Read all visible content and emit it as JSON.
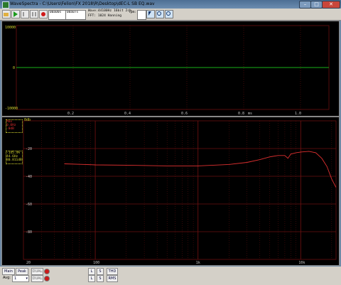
{
  "window": {
    "title": "WaveSpectra - C:\\Users\\Felion\\FX 2018\\R\\Desktop\\dEC-L SB EQ.wav",
    "min_glyph": "–",
    "max_glyph": "□",
    "close_glyph": "✕"
  },
  "toolbar": {
    "readout1": "00a00s",
    "readout2": "00a07s",
    "info_line1": "Wave:44100Hz 16bit 2ch",
    "info_line2": "FFT: 1024 Hanning",
    "fps_label": "fps:"
  },
  "wave_pane": {
    "y_max": "10000",
    "y_zero": "0",
    "y_min": "-10000",
    "x_ticks": [
      "0.2",
      "0.4",
      "0.6",
      "0.8",
      "1.0"
    ],
    "x_unit": "ms"
  },
  "spectrum_pane": {
    "top_label": "0db",
    "info_top": [
      "Max",
      "0.0Hz",
      "-0dB"
    ],
    "info_mid": [
      "-145.4%",
      "44.6Hz",
      "80.811dB"
    ],
    "y_ticks": [
      "-20",
      "-40",
      "-60",
      "-80"
    ],
    "x_ticks": [
      "20",
      "100",
      "1k",
      "10k"
    ]
  },
  "chart_data": {
    "type": "line",
    "title": "",
    "xlabel": "",
    "ylabel": "",
    "xscale": "log",
    "xlim": [
      20,
      22050
    ],
    "ylim": [
      -100,
      0
    ],
    "grid": true,
    "series": [
      {
        "color": "#e03030",
        "x": [
          50,
          80,
          100,
          200,
          500,
          1000,
          2000,
          3000,
          4000,
          5000,
          6000,
          7000,
          7500,
          8000,
          9000,
          10000,
          12000,
          14000,
          16000,
          18000,
          20000,
          22000
        ],
        "y": [
          -31,
          -31.5,
          -31.8,
          -32,
          -32.5,
          -32.5,
          -31.5,
          -30,
          -28,
          -26,
          -25,
          -25,
          -27,
          -24,
          -23,
          -22.5,
          -22,
          -23,
          -27,
          -33,
          -42,
          -48
        ]
      }
    ]
  },
  "bottom": {
    "row1": {
      "main": "Main",
      "peak": "Peak",
      "dual": "DUAL",
      "l": "L",
      "s": "S",
      "thd": "THD"
    },
    "row2": {
      "avg_label": "Avg:",
      "avg_value": "1",
      "dual": "DUAL",
      "l": "L",
      "s": "S",
      "rms": "RMS"
    }
  },
  "colors": {
    "grid": "#6a1010",
    "wave": "#18b018",
    "spectrum": "#e03030",
    "axis_text": "#c8c8c8",
    "info_yellow": "#d8d830"
  }
}
